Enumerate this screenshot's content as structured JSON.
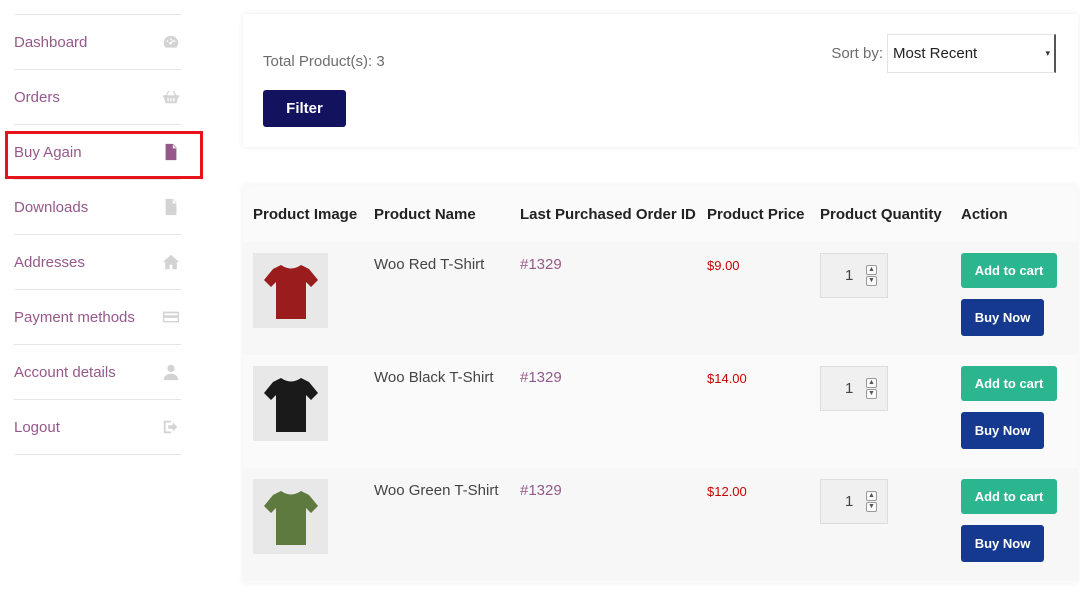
{
  "sidebar": {
    "items": [
      {
        "label": "Dashboard",
        "icon": "dashboard-icon"
      },
      {
        "label": "Orders",
        "icon": "basket-icon"
      },
      {
        "label": "Buy Again",
        "icon": "document-icon",
        "active": true
      },
      {
        "label": "Downloads",
        "icon": "file-download-icon"
      },
      {
        "label": "Addresses",
        "icon": "home-icon"
      },
      {
        "label": "Payment methods",
        "icon": "credit-card-icon"
      },
      {
        "label": "Account details",
        "icon": "user-icon"
      },
      {
        "label": "Logout",
        "icon": "logout-icon"
      }
    ]
  },
  "filter": {
    "total_label": "Total Product(s): 3",
    "filter_button": "Filter",
    "sort_label": "Sort by:",
    "sort_value": "Most Recent"
  },
  "table": {
    "headers": [
      "Product Image",
      "Product Name",
      "Last Purchased Order ID",
      "Product Price",
      "Product Quantity",
      "Action"
    ],
    "rows": [
      {
        "name": "Woo Red T-Shirt",
        "order_id": "#1329",
        "price": "$9.00",
        "quantity": "1",
        "shirt_color": "#9b1c1c",
        "add_to_cart": "Add to cart",
        "buy_now": "Buy Now"
      },
      {
        "name": "Woo Black T-Shirt",
        "order_id": "#1329",
        "price": "$14.00",
        "quantity": "1",
        "shirt_color": "#1a1a1a",
        "add_to_cart": "Add to cart",
        "buy_now": "Buy Now"
      },
      {
        "name": "Woo Green T-Shirt",
        "order_id": "#1329",
        "price": "$12.00",
        "quantity": "1",
        "shirt_color": "#5e7a3e",
        "add_to_cart": "Add to cart",
        "buy_now": "Buy Now"
      }
    ]
  },
  "colors": {
    "accent": "#96588a",
    "filter_button": "#13125f",
    "add_to_cart": "#2bb690",
    "buy_now": "#14398f",
    "price": "#cc0000",
    "highlight": "#e8131a"
  }
}
